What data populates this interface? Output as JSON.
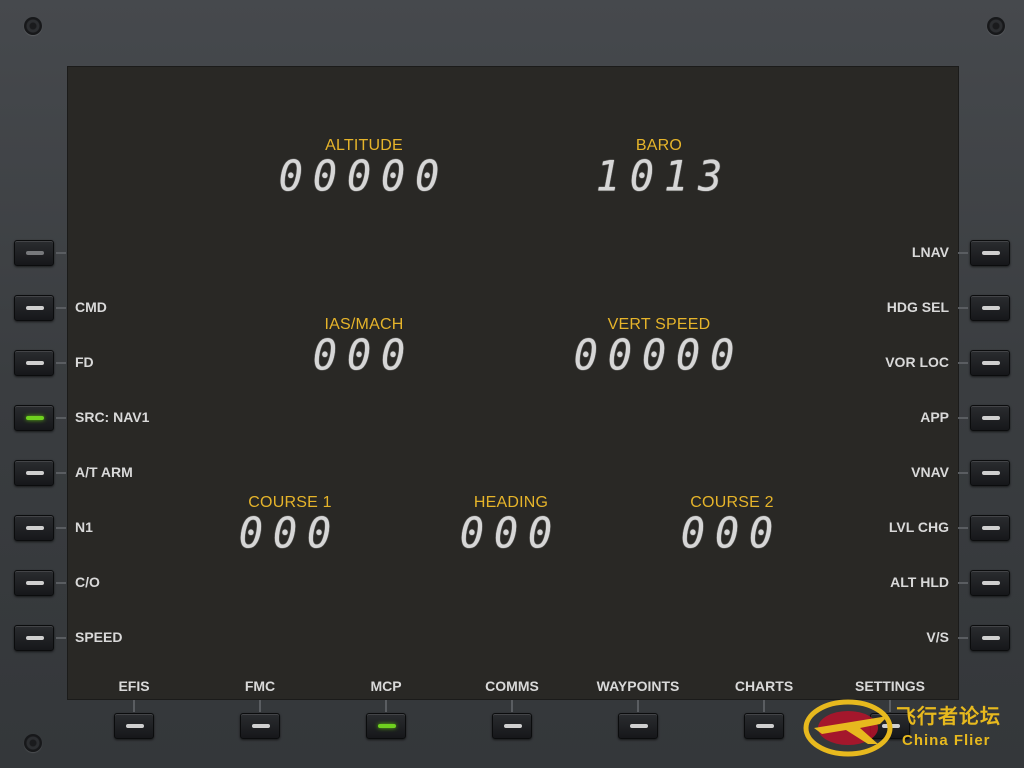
{
  "displays": {
    "altitude": {
      "label": "ALTITUDE",
      "value": "00000"
    },
    "baro": {
      "label": "BARO",
      "value": "1013"
    },
    "ias_mach": {
      "label": "IAS/MACH",
      "value": "000"
    },
    "vert_speed": {
      "label": "VERT SPEED",
      "value": "00000"
    },
    "course1": {
      "label": "COURSE 1",
      "value": "000"
    },
    "heading": {
      "label": "HEADING",
      "value": "000"
    },
    "course2": {
      "label": "COURSE 2",
      "value": "000"
    }
  },
  "left_buttons": [
    {
      "label": "",
      "state": "off"
    },
    {
      "label": "CMD",
      "state": "off"
    },
    {
      "label": "FD",
      "state": "off"
    },
    {
      "label": "SRC: NAV1",
      "state": "on"
    },
    {
      "label": "A/T ARM",
      "state": "off"
    },
    {
      "label": "N1",
      "state": "off"
    },
    {
      "label": "C/O",
      "state": "off"
    },
    {
      "label": "SPEED",
      "state": "off"
    }
  ],
  "right_buttons": [
    {
      "label": "LNAV",
      "state": "off"
    },
    {
      "label": "HDG SEL",
      "state": "off"
    },
    {
      "label": "VOR LOC",
      "state": "off"
    },
    {
      "label": "APP",
      "state": "off"
    },
    {
      "label": "VNAV",
      "state": "off"
    },
    {
      "label": "LVL CHG",
      "state": "off"
    },
    {
      "label": "ALT HLD",
      "state": "off"
    },
    {
      "label": "V/S",
      "state": "off"
    }
  ],
  "bottom_tabs": [
    {
      "label": "EFIS",
      "state": "off"
    },
    {
      "label": "FMC",
      "state": "off"
    },
    {
      "label": "MCP",
      "state": "on"
    },
    {
      "label": "COMMS",
      "state": "off"
    },
    {
      "label": "WAYPOINTS",
      "state": "off"
    },
    {
      "label": "CHARTS",
      "state": "off"
    },
    {
      "label": "SETTINGS",
      "state": "off"
    }
  ],
  "colors": {
    "label_amber": "#e6b42a",
    "lamp_on": "#6fd11f",
    "screen_bg": "#292825"
  },
  "watermark": {
    "cn": "飞行者论坛",
    "en": "China Flier",
    "icon": "plane-logo-icon"
  }
}
